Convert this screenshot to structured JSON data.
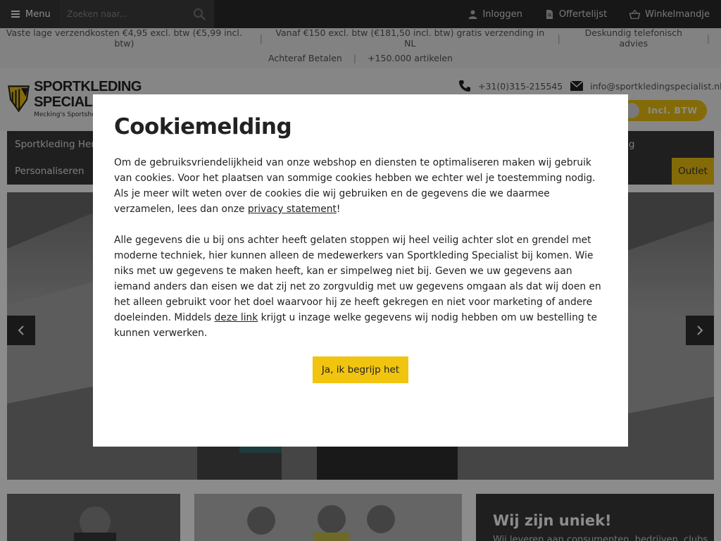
{
  "topbar": {
    "menu_label": "Menu",
    "search_placeholder": "Zoeken naar...",
    "links": [
      {
        "label": "Inloggen",
        "icon": "user-icon"
      },
      {
        "label": "Offertelijst",
        "icon": "document-icon"
      },
      {
        "label": "Winkelmandje",
        "icon": "basket-icon"
      }
    ]
  },
  "usp": {
    "row1": [
      "Vaste lage verzendkosten €4,95 excl. btw (€5,99 incl. btw)",
      "Vanaf €150 excl. btw (€181,50 incl. btw) gratis verzending in NL",
      "Deskundig telefonisch advies"
    ],
    "row2": [
      "Achteraf Betalen",
      "+150.000 artikelen"
    ]
  },
  "header": {
    "logo_line1": "SPORTKLEDING",
    "logo_line2": "SPECIAL",
    "logo_tagline": "Mecking's Sportshop",
    "phone": "+31(0)315-215545",
    "email": "info@sportkledingspecialist.nl",
    "btw_label": "Incl. BTW"
  },
  "nav": {
    "row1_first": "Sportkleding Heren",
    "row1_last": "ding",
    "row2_first": "Personaliseren",
    "outlet": "Outlet"
  },
  "tiles": {
    "unique_title": "Wij zijn uniek!",
    "unique_sub": "Wij leveren aan consumenten, bedrijven, clubs"
  },
  "modal": {
    "title": "Cookiemelding",
    "p1_before": "Om de gebruiksvriendelijkheid van onze webshop en diensten te optimaliseren maken wij gebruik van cookies. Voor het plaatsen van sommige cookies hebben we echter wel je toestemming nodig. Als je meer wilt weten over de cookies die wij gebruiken en de gegevens die we daarmee verzamelen, lees dan onze ",
    "p1_link": "privacy statement",
    "p1_after": "!",
    "p2_before": "Alle gegevens die u bij ons achter heeft gelaten stoppen wij heel veilig achter slot en grendel met moderne techniek, hier kunnen alleen de medewerkers van Sportkleding Specialist bij komen. Wie niks met uw gegevens te maken heeft, kan er simpelweg niet bij. Geven we uw gegevens aan iemand anders dan eisen we dat zij net zo zorgvuldig met uw gegevens omgaan als dat wij doen en het alleen gebruikt voor het doel waarvoor hij ze heeft gekregen en niet voor marketing of andere doeleinden. Middels ",
    "p2_link": "deze link",
    "p2_after": " krijgt u inzage welke gegevens wij nodig hebben om uw bestelling te kunnen verwerken.",
    "accept_label": "Ja, ik begrijp het"
  },
  "colors": {
    "accent": "#f1c40f",
    "dark": "#2a2a2a"
  }
}
